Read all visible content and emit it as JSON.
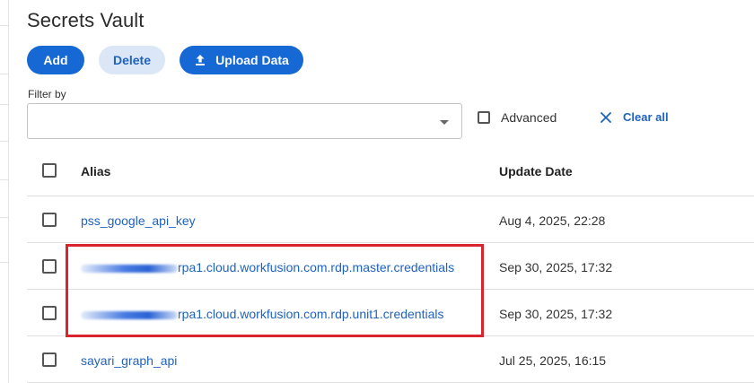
{
  "page": {
    "title": "Secrets Vault"
  },
  "toolbar": {
    "add_label": "Add",
    "delete_label": "Delete",
    "upload_label": "Upload Data"
  },
  "filter": {
    "label": "Filter by",
    "value": "",
    "advanced_label": "Advanced",
    "clear_all_label": "Clear all"
  },
  "table": {
    "columns": {
      "alias": "Alias",
      "update_date": "Update Date"
    },
    "rows": [
      {
        "alias": "pss_google_api_key",
        "update_date": "Aug 4, 2025, 22:28"
      },
      {
        "alias": "rpa1.cloud.workfusion.com.rdp.master.credentials",
        "update_date": "Sep 30, 2025, 17:32"
      },
      {
        "alias": "rpa1.cloud.workfusion.com.rdp.unit1.credentials",
        "update_date": "Sep 30, 2025, 17:32"
      },
      {
        "alias": "sayari_graph_api",
        "update_date": "Jul 25, 2025, 16:15"
      }
    ]
  },
  "colors": {
    "accent": "#1668d4",
    "link": "#1f62bf",
    "highlight": "#d9232d"
  }
}
